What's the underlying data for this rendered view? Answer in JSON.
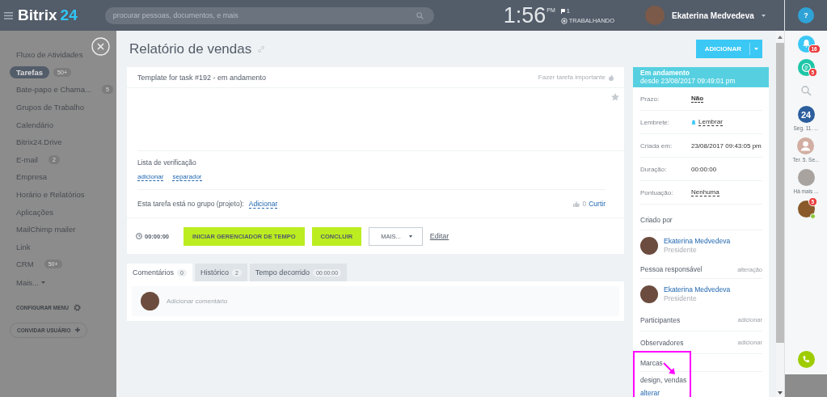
{
  "header": {
    "logo_main": "Bitrix",
    "logo_accent": "24",
    "search": {
      "placeholder": "procurar pessoas, documentos, e mais"
    },
    "clock": {
      "time": "1:56",
      "meridiem": "PM",
      "flag_count": "1",
      "status": "TRABALHANDO"
    },
    "user": {
      "name": "Ekaterina Medvedeva"
    }
  },
  "sidebar": {
    "items": [
      {
        "label": "Fluxo de Atividades",
        "selected": false
      },
      {
        "label": "Tarefas",
        "selected": true,
        "count": "50+"
      },
      {
        "label": "Bate-papo e Chama...",
        "selected": false,
        "count": "5"
      },
      {
        "label": "Grupos de Trabalho",
        "selected": false
      },
      {
        "label": "Calendário",
        "selected": false
      },
      {
        "label": "Bitrix24.Drive",
        "selected": false
      },
      {
        "label": "E-mail",
        "selected": false,
        "count": "2"
      },
      {
        "label": "Empresa",
        "selected": false
      },
      {
        "label": "Horário e Relatórios",
        "selected": false
      },
      {
        "label": "Aplicações",
        "selected": false
      },
      {
        "label": "MailChimp mailer",
        "selected": false
      },
      {
        "label": "Link",
        "selected": false
      },
      {
        "label": "CRM",
        "selected": false,
        "count": "50+"
      }
    ],
    "more": "Mais...",
    "configure": "CONFIGURAR MENU",
    "invite": "CONVIDAR USUÁRIO"
  },
  "page": {
    "title": "Relatório de vendas",
    "add_button": "ADICIONAR"
  },
  "task": {
    "header": "Template for task #192 - em andamento",
    "important": "Fazer tarefa importante",
    "checklist": {
      "title": "Lista de verificação",
      "links": [
        "adicionar",
        "separador"
      ]
    },
    "group": {
      "text": "Esta tarefa está no grupo (projeto):",
      "link": "Adicionar"
    },
    "like": {
      "count": "0",
      "label": "Curtir"
    },
    "timer": "00:00:00",
    "buttons": [
      {
        "label": "INICIAR GERENCIADOR DE TEMPO",
        "kind": "primary"
      },
      {
        "label": "CONCLUIR",
        "kind": "primary"
      },
      {
        "label": "MAIS...",
        "kind": "dropdown"
      },
      {
        "label": "Editar",
        "kind": "link"
      }
    ]
  },
  "tabs": [
    {
      "label": "Comentários",
      "count": "0",
      "selected": true
    },
    {
      "label": "Histórico",
      "count": "2",
      "selected": false
    },
    {
      "label": "Tempo decorrido",
      "count": "00:00:00",
      "selected": false
    }
  ],
  "comment": {
    "placeholder": "Adicionar comentário"
  },
  "panel": {
    "status": {
      "title": "Em andamento",
      "since": "desde 23/08/2017 09:49:01 pm"
    },
    "fields": [
      {
        "label": "Prazo:",
        "value": "Não",
        "kind": "dotted"
      },
      {
        "label": "Lembrete:",
        "value": "Lembrar",
        "kind": "reminder"
      },
      {
        "label": "Criada em:",
        "value": "23/08/2017 09:43:05 pm",
        "kind": "plain"
      },
      {
        "label": "Duração:",
        "value": "00:00:00",
        "kind": "plain"
      },
      {
        "label": "Pontuação:",
        "value": "Nenhuma",
        "kind": "dotted"
      }
    ],
    "people": [
      {
        "title": "Criado por",
        "name": "Ekaterina Medvedeva",
        "role": "Presidente"
      },
      {
        "title": "Pessoa responsável",
        "action": "alteração",
        "name": "Ekaterina Medvedeva",
        "role": "Presidente"
      }
    ],
    "roles": [
      {
        "title": "Participantes",
        "action": "adicionar"
      },
      {
        "title": "Observadores",
        "action": "adicionar"
      }
    ],
    "tags": {
      "title": "Marcas",
      "value": "design, vendas",
      "action": "alterar",
      "highlighted": true
    }
  },
  "right_bar": {
    "help": "?",
    "items": [
      {
        "kind": "bell",
        "badge": "16"
      },
      {
        "kind": "chat",
        "badge": "5"
      },
      {
        "kind": "search"
      },
      {
        "kind": "logo",
        "text": "24",
        "caption": "Seg. 11. ..."
      },
      {
        "kind": "user",
        "caption": "Ter. 5. Se..."
      },
      {
        "kind": "photo",
        "caption": "Há mais ..."
      },
      {
        "kind": "group-photo",
        "badge": "5",
        "online": true
      }
    ]
  }
}
